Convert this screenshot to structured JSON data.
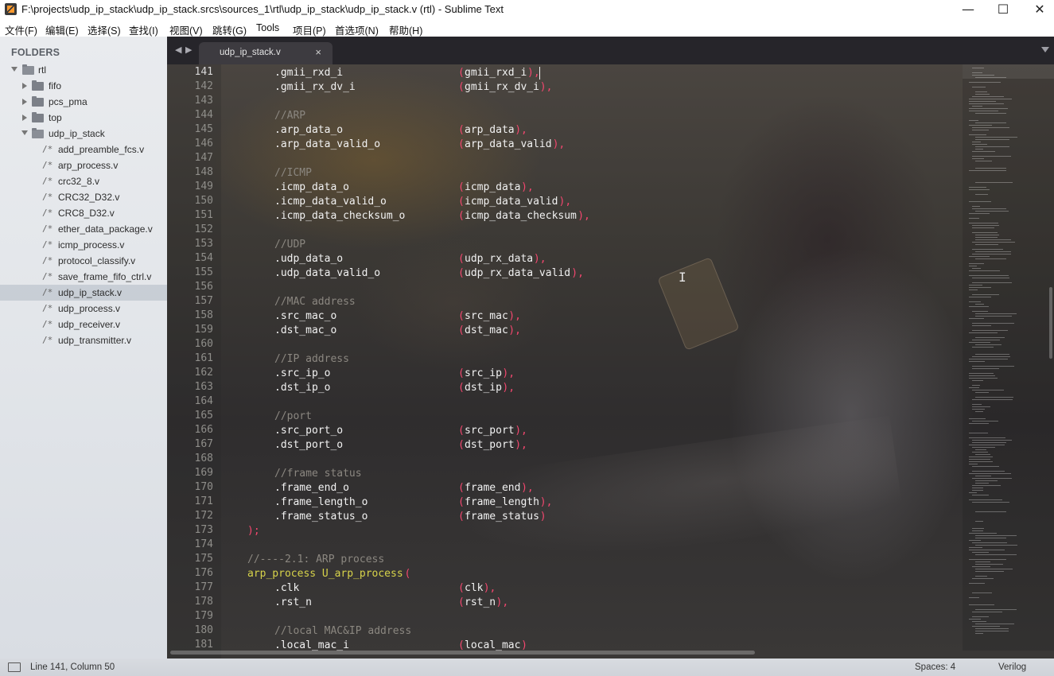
{
  "window": {
    "title": "F:\\projects\\udp_ip_stack\\udp_ip_stack.srcs\\sources_1\\rtl\\udp_ip_stack\\udp_ip_stack.v (rtl) - Sublime Text",
    "minimize_glyph": "—",
    "maximize_glyph": "☐",
    "close_glyph": "✕"
  },
  "menu": [
    "文件(F)",
    "编辑(E)",
    "选择(S)",
    "查找(I)",
    "视图(V)",
    "跳转(G)",
    "Tools",
    "项目(P)",
    "首选项(N)",
    "帮助(H)"
  ],
  "sidebar": {
    "header": "FOLDERS",
    "root": "rtl",
    "folders": [
      "fifo",
      "pcs_pma",
      "top"
    ],
    "open_folder": "udp_ip_stack",
    "file_prefix": "/*",
    "files": [
      "add_preamble_fcs.v",
      "arp_process.v",
      "crc32_8.v",
      "CRC32_D32.v",
      "CRC8_D32.v",
      "ether_data_package.v",
      "icmp_process.v",
      "protocol_classify.v",
      "save_frame_fifo_ctrl.v",
      "udp_ip_stack.v",
      "udp_process.v",
      "udp_receiver.v",
      "udp_transmitter.v"
    ],
    "selected_file": "udp_ip_stack.v"
  },
  "tabs": {
    "nav_back": "◀",
    "nav_forward": "▶",
    "active_tab": "udp_ip_stack.v",
    "close_glyph": "×"
  },
  "editor": {
    "current_line": 141,
    "lines": [
      {
        "n": 141,
        "indent": 2,
        "port": ".gmii_rxd_i",
        "sig": "gmii_rxd_i",
        "end": "),"
      },
      {
        "n": 142,
        "indent": 2,
        "port": ".gmii_rx_dv_i",
        "sig": "gmii_rx_dv_i",
        "end": "),"
      },
      {
        "n": 143
      },
      {
        "n": 144,
        "indent": 2,
        "comment": "//ARP"
      },
      {
        "n": 145,
        "indent": 2,
        "port": ".arp_data_o",
        "sig": "arp_data",
        "end": "),"
      },
      {
        "n": 146,
        "indent": 2,
        "port": ".arp_data_valid_o",
        "sig": "arp_data_valid",
        "end": "),"
      },
      {
        "n": 147
      },
      {
        "n": 148,
        "indent": 2,
        "comment": "//ICMP"
      },
      {
        "n": 149,
        "indent": 2,
        "port": ".icmp_data_o",
        "sig": "icmp_data",
        "end": "),"
      },
      {
        "n": 150,
        "indent": 2,
        "port": ".icmp_data_valid_o",
        "sig": "icmp_data_valid",
        "end": "),"
      },
      {
        "n": 151,
        "indent": 2,
        "port": ".icmp_data_checksum_o",
        "sig": "icmp_data_checksum",
        "end": "),"
      },
      {
        "n": 152
      },
      {
        "n": 153,
        "indent": 2,
        "comment": "//UDP"
      },
      {
        "n": 154,
        "indent": 2,
        "port": ".udp_data_o",
        "sig": "udp_rx_data",
        "end": "),"
      },
      {
        "n": 155,
        "indent": 2,
        "port": ".udp_data_valid_o",
        "sig": "udp_rx_data_valid",
        "end": "),"
      },
      {
        "n": 156
      },
      {
        "n": 157,
        "indent": 2,
        "comment": "//MAC address"
      },
      {
        "n": 158,
        "indent": 2,
        "port": ".src_mac_o",
        "sig": "src_mac",
        "end": "),"
      },
      {
        "n": 159,
        "indent": 2,
        "port": ".dst_mac_o",
        "sig": "dst_mac",
        "end": "),"
      },
      {
        "n": 160
      },
      {
        "n": 161,
        "indent": 2,
        "comment": "//IP address"
      },
      {
        "n": 162,
        "indent": 2,
        "port": ".src_ip_o",
        "sig": "src_ip",
        "end": "),"
      },
      {
        "n": 163,
        "indent": 2,
        "port": ".dst_ip_o",
        "sig": "dst_ip",
        "end": "),"
      },
      {
        "n": 164
      },
      {
        "n": 165,
        "indent": 2,
        "comment": "//port"
      },
      {
        "n": 166,
        "indent": 2,
        "port": ".src_port_o",
        "sig": "src_port",
        "end": "),"
      },
      {
        "n": 167,
        "indent": 2,
        "port": ".dst_port_o",
        "sig": "dst_port",
        "end": "),"
      },
      {
        "n": 168
      },
      {
        "n": 169,
        "indent": 2,
        "comment": "//frame status"
      },
      {
        "n": 170,
        "indent": 2,
        "port": ".frame_end_o",
        "sig": "frame_end",
        "end": "),"
      },
      {
        "n": 171,
        "indent": 2,
        "port": ".frame_length_o",
        "sig": "frame_length",
        "end": "),"
      },
      {
        "n": 172,
        "indent": 2,
        "port": ".frame_status_o",
        "sig": "frame_status",
        "end": ")"
      },
      {
        "n": 173,
        "indent": 1,
        "punct": ");"
      },
      {
        "n": 174
      },
      {
        "n": 175,
        "indent": 1,
        "comment": "//----2.1: ARP process"
      },
      {
        "n": 176,
        "indent": 1,
        "module": "arp_process U_arp_process",
        "open": "("
      },
      {
        "n": 177,
        "indent": 2,
        "port": ".clk",
        "sig": "clk",
        "end": "),"
      },
      {
        "n": 178,
        "indent": 2,
        "port": ".rst_n",
        "sig": "rst_n",
        "end": "),"
      },
      {
        "n": 179
      },
      {
        "n": 180,
        "indent": 2,
        "comment": "//local MAC&IP address"
      },
      {
        "n": 181,
        "indent": 2,
        "port": ".local_mac_i",
        "sig": "local_mac",
        "end": ")"
      }
    ],
    "text_cursor_glyph": "I"
  },
  "status": {
    "position": "Line 141, Column 50",
    "spaces": "Spaces: 4",
    "syntax": "Verilog"
  },
  "colors": {
    "paren": "#f4476f",
    "comment": "#8b8780",
    "module": "#d7d34a",
    "text": "#f2f2f2"
  }
}
